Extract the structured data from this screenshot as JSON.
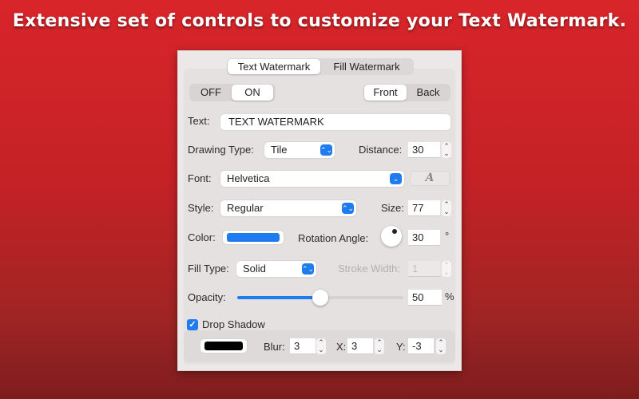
{
  "headline": "Extensive set of controls to customize your Text Watermark.",
  "tabs": [
    {
      "label": "Text Watermark",
      "active": true
    },
    {
      "label": "Fill Watermark",
      "active": false
    }
  ],
  "power": {
    "options": [
      "OFF",
      "ON"
    ],
    "selected": "ON"
  },
  "layer": {
    "options": [
      "Front",
      "Back"
    ],
    "selected": "Front"
  },
  "text": {
    "label": "Text:",
    "value": "TEXT WATERMARK"
  },
  "drawing_type": {
    "label": "Drawing Type:",
    "value": "Tile"
  },
  "distance": {
    "label": "Distance:",
    "value": "30"
  },
  "font": {
    "label": "Font:",
    "value": "Helvetica",
    "font_button_glyph": "A"
  },
  "style": {
    "label": "Style:",
    "value": "Regular"
  },
  "size": {
    "label": "Size:",
    "value": "77"
  },
  "color": {
    "label": "Color:",
    "value": "#1f7cf0"
  },
  "rotation": {
    "label": "Rotation Angle:",
    "value": "30",
    "unit": "°"
  },
  "fill_type": {
    "label": "Fill Type:",
    "value": "Solid"
  },
  "stroke_width": {
    "label": "Stroke Width:",
    "value": "1",
    "enabled": false
  },
  "opacity": {
    "label": "Opacity:",
    "value": "50",
    "unit": "%",
    "fraction": 0.5
  },
  "drop_shadow": {
    "label": "Drop Shadow",
    "checked": true,
    "color": "#000000",
    "blur": {
      "label": "Blur:",
      "value": "3"
    },
    "x": {
      "label": "X:",
      "value": "3"
    },
    "y": {
      "label": "Y:",
      "value": "-3"
    }
  },
  "icons": {
    "popup_chevron": "⌃⌄",
    "dropdown_chevron": "⌄",
    "stepper_up": "⌃",
    "stepper_down": "⌄",
    "check": "✓"
  }
}
